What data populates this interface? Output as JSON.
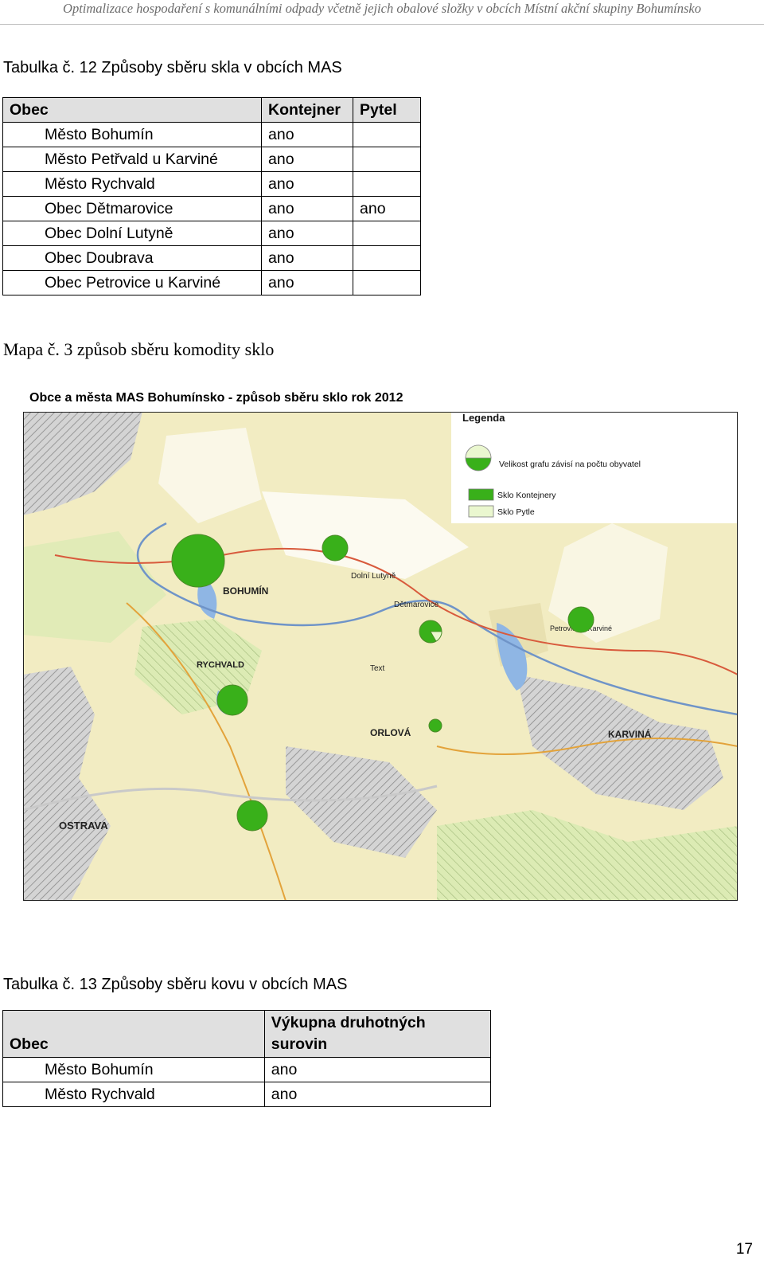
{
  "header": {
    "text": "Optimalizace hospodaření s komunálními odpady včetně jejich obalové složky v obcích Místní akční skupiny Bohumínsko"
  },
  "table12": {
    "caption": "Tabulka č. 12 Způsoby sběru skla v obcích MAS",
    "headers": [
      "Obec",
      "Kontejner",
      "Pytel"
    ],
    "rows": [
      [
        "Město Bohumín",
        "ano",
        ""
      ],
      [
        "Město Petřvald u Karviné",
        "ano",
        ""
      ],
      [
        "Město Rychvald",
        "ano",
        ""
      ],
      [
        "Obec Dětmarovice",
        "ano",
        "ano"
      ],
      [
        "Obec Dolní Lutyně",
        "ano",
        ""
      ],
      [
        "Obec Doubrava",
        "ano",
        ""
      ],
      [
        "Obec Petrovice u Karviné",
        "ano",
        ""
      ]
    ]
  },
  "map": {
    "caption": "Mapa č. 3 způsob sběru komodity sklo",
    "title": "Obce a města MAS Bohumínsko - způsob sběru sklo rok 2012",
    "legend": {
      "title": "Legenda",
      "size_note": "Velikost grafu závisí na počtu obyvatel",
      "items": [
        {
          "label": "Sklo Kontejnery",
          "color": "#39b01a"
        },
        {
          "label": "Sklo Pytle",
          "color": "#eaf7cf"
        }
      ]
    },
    "place_labels": [
      "BOHUMÍN",
      "RYCHVALD",
      "Dolní Lutyně",
      "Dětmarovice",
      "Petrovice u Karviné",
      "ORLOVÁ",
      "KARVINÁ",
      "OSTRAVA",
      "Text"
    ],
    "colors": {
      "container": "#39b01a",
      "bag": "#eaf7cf",
      "land": "#f2ecc2",
      "meadow": "#dcebb4"
    }
  },
  "table13": {
    "caption": "Tabulka č. 13 Způsoby sběru kovu v obcích MAS",
    "headers": [
      "Obec",
      "Výkupna druhotných surovin"
    ],
    "rows": [
      [
        "Město Bohumín",
        "ano"
      ],
      [
        "Město Rychvald",
        "ano"
      ]
    ]
  },
  "page_number": "17"
}
